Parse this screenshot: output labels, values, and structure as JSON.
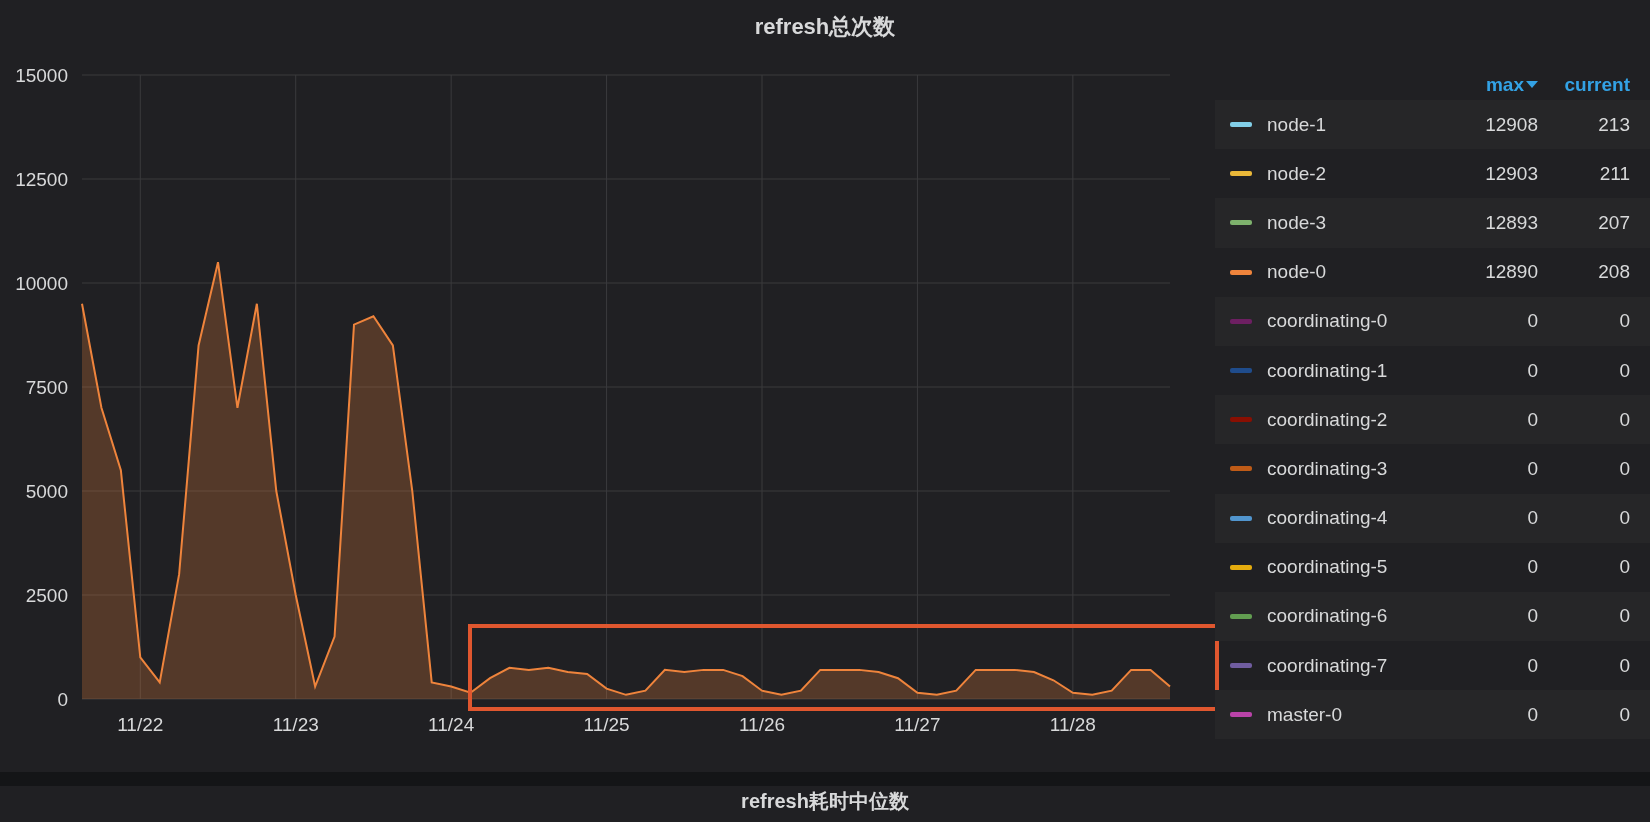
{
  "panel": {
    "title": "refresh总次数",
    "chart_data": {
      "type": "area",
      "grid": true,
      "ylim": [
        0,
        15000
      ],
      "yticks": [
        0,
        2500,
        5000,
        7500,
        10000,
        12500,
        15000
      ],
      "categories": [
        null,
        null,
        null,
        "11/22",
        null,
        null,
        null,
        null,
        null,
        null,
        null,
        "11/23",
        null,
        null,
        null,
        null,
        null,
        null,
        null,
        "11/24",
        null,
        null,
        null,
        null,
        null,
        null,
        null,
        "11/25",
        null,
        null,
        null,
        null,
        null,
        null,
        null,
        "11/26",
        null,
        null,
        null,
        null,
        null,
        null,
        null,
        "11/27",
        null,
        null,
        null,
        null,
        null,
        null,
        null,
        "11/28",
        null,
        null,
        null,
        null,
        null
      ],
      "series": [
        {
          "color": "#ef843c",
          "values": [
            9500,
            7000,
            5500,
            1000,
            400,
            3000,
            8500,
            10500,
            7000,
            9500,
            5000,
            2500,
            300,
            1500,
            9000,
            9200,
            8500,
            5000,
            400,
            300,
            150,
            500,
            750,
            700,
            750,
            650,
            600,
            250,
            100,
            200,
            700,
            650,
            700,
            700,
            550,
            200,
            100,
            200,
            700,
            700,
            700,
            650,
            500,
            150,
            100,
            200,
            700,
            700,
            700,
            650,
            450,
            150,
            100,
            200,
            700,
            700,
            300
          ]
        }
      ]
    },
    "highlight": {
      "color": "#e0572f"
    },
    "legend": {
      "columns": [
        {
          "label": "max",
          "sorted": true
        },
        {
          "label": "current",
          "sorted": false
        }
      ],
      "items": [
        {
          "name": "node-1",
          "color": "#82cfe8",
          "max": "12908",
          "current": "213"
        },
        {
          "name": "node-2",
          "color": "#eab839",
          "max": "12903",
          "current": "211"
        },
        {
          "name": "node-3",
          "color": "#7eb26d",
          "max": "12893",
          "current": "207"
        },
        {
          "name": "node-0",
          "color": "#ef843c",
          "max": "12890",
          "current": "208"
        },
        {
          "name": "coordinating-0",
          "color": "#6d1f62",
          "max": "0",
          "current": "0"
        },
        {
          "name": "coordinating-1",
          "color": "#1f4c8c",
          "max": "0",
          "current": "0"
        },
        {
          "name": "coordinating-2",
          "color": "#890f02",
          "max": "0",
          "current": "0"
        },
        {
          "name": "coordinating-3",
          "color": "#bf5b17",
          "max": "0",
          "current": "0"
        },
        {
          "name": "coordinating-4",
          "color": "#5195ce",
          "max": "0",
          "current": "0"
        },
        {
          "name": "coordinating-5",
          "color": "#e5ac0e",
          "max": "0",
          "current": "0"
        },
        {
          "name": "coordinating-6",
          "color": "#629e51",
          "max": "0",
          "current": "0"
        },
        {
          "name": "coordinating-7",
          "color": "#705da0",
          "max": "0",
          "current": "0"
        },
        {
          "name": "master-0",
          "color": "#ba43a9",
          "max": "0",
          "current": "0"
        }
      ]
    }
  },
  "next_panel": {
    "title": "refresh耗时中位数"
  }
}
